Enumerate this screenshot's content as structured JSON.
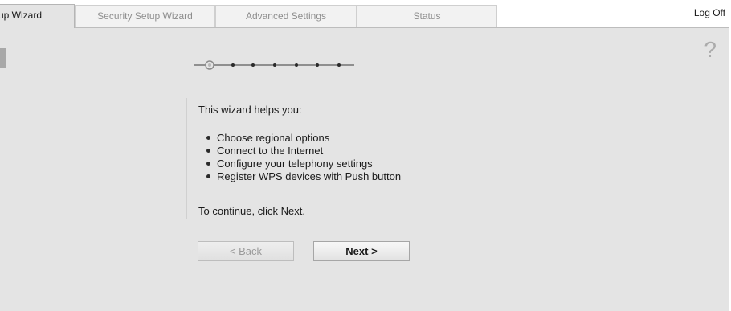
{
  "tabs": [
    {
      "label": "up Wizard",
      "active": true
    },
    {
      "label": "Security Setup Wizard",
      "active": false
    },
    {
      "label": "Advanced Settings",
      "active": false
    },
    {
      "label": "Status",
      "active": false
    }
  ],
  "header": {
    "logoff_label": "Log Off"
  },
  "help": {
    "icon": "?"
  },
  "progress": {
    "steps_total": 7,
    "current_step": 1
  },
  "wizard": {
    "intro": "This wizard helps you:",
    "bullets": [
      "Choose regional options",
      "Connect to the Internet",
      "Configure your telephony settings",
      "Register WPS devices with Push button"
    ],
    "continue_text": "To continue, click Next.",
    "back_label": "< Back",
    "next_label": "Next >"
  },
  "colors": {
    "panel_bg": "#e4e4e4",
    "tab_inactive_bg": "#f2f2f2",
    "tab_inactive_text": "#8e8e8e",
    "text": "#1a1a1a"
  }
}
